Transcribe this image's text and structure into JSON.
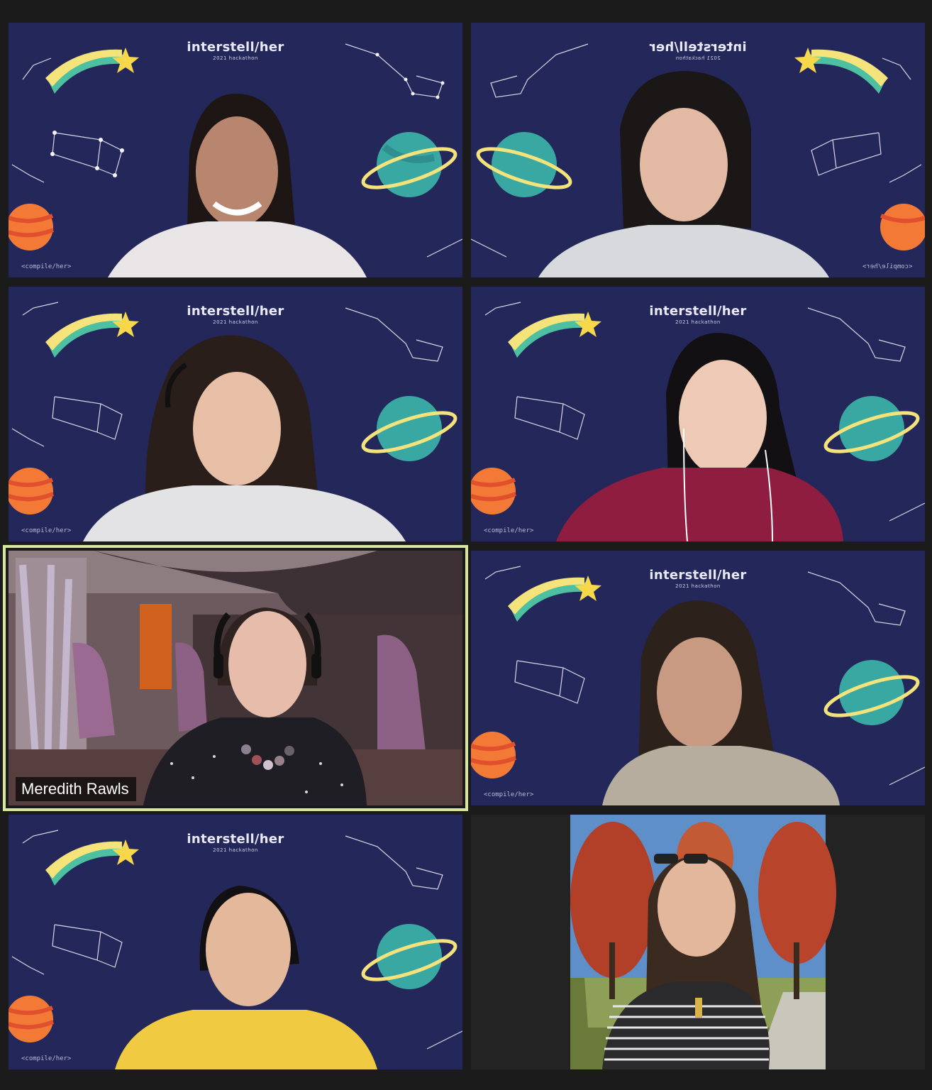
{
  "app": {
    "view": "gallery",
    "background_color": "#1b1b1b",
    "active_speaker_border_color": "#d9e6a0"
  },
  "virtual_background": {
    "title": "interstell/her",
    "subtitle": "2021 hackathon",
    "tag": "<compile/her>",
    "bg_color": "#24275a"
  },
  "participants": [
    {
      "name": "",
      "shirt": "#e9e4e6",
      "hair": "#1d1615",
      "skin": "#b8866f",
      "background": "virtual"
    },
    {
      "name": "",
      "shirt": "#d7d9dc",
      "hair": "#1a1716",
      "skin": "#e2b9a2",
      "background": "virtual-mirrored"
    },
    {
      "name": "",
      "shirt": "#e3e3e6",
      "hair": "#2a1e1a",
      "skin": "#e7bfa7",
      "background": "virtual"
    },
    {
      "name": "",
      "shirt": "#8e1d3f",
      "hair": "#121012",
      "skin": "#eec9b5",
      "background": "virtual"
    },
    {
      "name": "Meredith Rawls",
      "shirt": "#1e1e24",
      "hair": "#2e2320",
      "skin": "#e6bcab",
      "background": "starship-lounge",
      "active_speaker": true
    },
    {
      "name": "",
      "shirt": "#b7ad9f",
      "hair": "#2d211c",
      "skin": "#c99a82",
      "background": "virtual"
    },
    {
      "name": "",
      "shirt": "#f0cb41",
      "hair": "#121012",
      "skin": "#e4b99b",
      "background": "virtual"
    },
    {
      "name": "",
      "shirt": "#2b2b2d",
      "hair": "#3a2a20",
      "skin": "#e3b79c",
      "background": "autumn-trees-photo"
    }
  ]
}
